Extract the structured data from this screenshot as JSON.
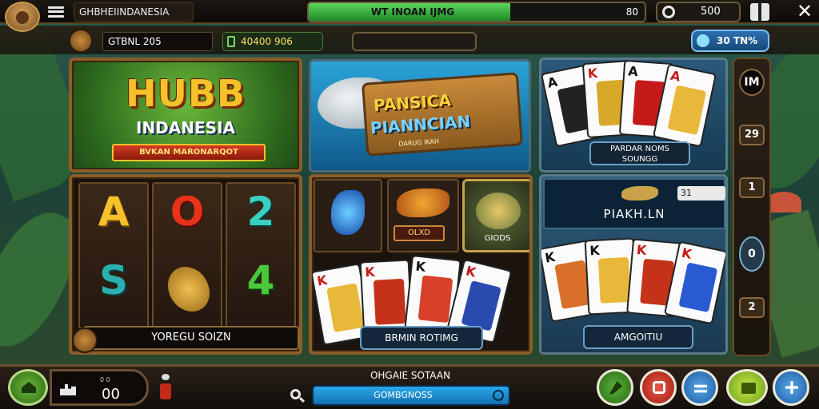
{
  "top_bar": {
    "title": "GHBHEIINDANESIA",
    "progress_label": "WT INOAN IJMG",
    "progress_fraction": 0.6,
    "progress_value": "80",
    "coins": "500"
  },
  "sub_bar": {
    "player_name": "GTBNL 205",
    "credit": "40400 906",
    "level": "30 TN%"
  },
  "tiles": {
    "hub": {
      "title": "HUBB",
      "subtitle": "INDANESIA",
      "ribbon": "BVKAN MARONARQOT"
    },
    "fish": {
      "line1": "PANSICA",
      "line2": "PIANNCIAN",
      "line3": "DARUG IKAH"
    },
    "cards_top": {
      "label_line1": "PARDAR NOMS",
      "label_line2": "SOUNGG"
    },
    "slots": {
      "symbols": [
        "A",
        "O",
        "2",
        "S",
        "",
        "4"
      ],
      "label": "YOREGU SOIZN"
    },
    "mix": {
      "tag": "OLXD",
      "goods": "GIODS",
      "label": "BRMIN ROTIMG"
    },
    "poker": {
      "count": "31",
      "name": "PIAKH.LN",
      "label": "AMGOITIU"
    }
  },
  "rail": {
    "top": "IM",
    "items": [
      "29",
      "1",
      "0",
      "2"
    ]
  },
  "bottom_bar": {
    "stat_value": "00",
    "stat_indicator": "0 0",
    "caption": "OHGAIE SOTAAN",
    "field_text": "GOMBGNOSS"
  },
  "colors": {
    "accent_gold": "#f5c22a",
    "progress_green": "#3cb043",
    "panel_blue": "#1a5aa2",
    "wood": "#8a5e2a"
  },
  "icons": [
    "avatar",
    "menu-icon",
    "coin-icon",
    "gift-icon",
    "close-icon",
    "lock-badge-icon",
    "wallet-icon",
    "level-gem-icon",
    "home-icon",
    "chart-icon",
    "search-icon",
    "confirm-icon"
  ]
}
